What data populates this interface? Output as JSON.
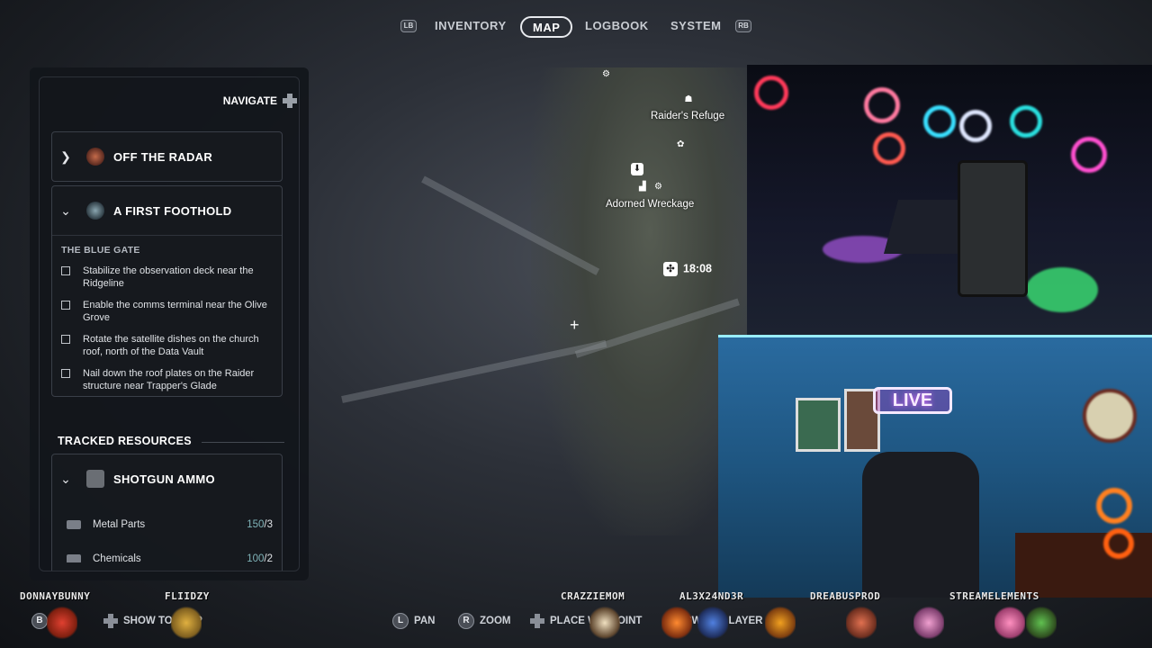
{
  "top_nav": {
    "left_bumper": "LB",
    "right_bumper": "RB",
    "tabs": [
      {
        "label": "INVENTORY",
        "active": false
      },
      {
        "label": "MAP",
        "active": true
      },
      {
        "label": "LOGBOOK",
        "active": false
      },
      {
        "label": "SYSTEM",
        "active": false
      }
    ]
  },
  "panel": {
    "navigate_label": "NAVIGATE",
    "quests": [
      {
        "title": "OFF THE RADAR",
        "expanded": false,
        "icon": "quest-emblem-icon"
      },
      {
        "title": "A FIRST FOOTHOLD",
        "expanded": true,
        "icon": "quest-emblem-icon",
        "subheading": "THE BLUE GATE",
        "objectives": [
          {
            "text": "Stabilize the observation deck near the Ridgeline",
            "done": false
          },
          {
            "text": "Enable the comms terminal near the Olive Grove",
            "done": false
          },
          {
            "text": "Rotate the satellite dishes on the church roof, north of the Data Vault",
            "done": false
          },
          {
            "text": "Nail down the roof plates on the Raider structure near Trapper's Glade",
            "done": false
          }
        ]
      }
    ],
    "tracked_heading": "TRACKED RESOURCES",
    "tracked_item": {
      "title": "SHOTGUN AMMO",
      "expanded": true,
      "resources": [
        {
          "name": "Metal Parts",
          "have": "150",
          "need": "/3"
        },
        {
          "name": "Chemicals",
          "have": "100",
          "need": "/2"
        }
      ]
    }
  },
  "map": {
    "locations": [
      {
        "label": "Raider's Refuge"
      },
      {
        "label": "Adorned Wreckage"
      }
    ],
    "timer": "18:08"
  },
  "overlay_names": [
    "DONNAYBUNNY",
    "FLIIDZY",
    "CRAZZIEMOM",
    "AL3X24ND3R",
    "DREABUSPROD",
    "STREAMELEMENTS"
  ],
  "webcam": {
    "live_sign": "LIVE"
  },
  "bottom_hints": [
    {
      "button": "B",
      "label": "SHOW TOOLTIP"
    },
    {
      "button": "L",
      "label": "PAN"
    },
    {
      "button": "R",
      "label": "ZOOM"
    },
    {
      "button": "dpad",
      "label": "PLACE WAYPOINT"
    },
    {
      "button": "X",
      "label": "SWITCH LAYER"
    }
  ],
  "colors": {
    "panel_bg": "#12151b",
    "accent_cyan": "#7fb3b8",
    "text": "#ffffff"
  }
}
